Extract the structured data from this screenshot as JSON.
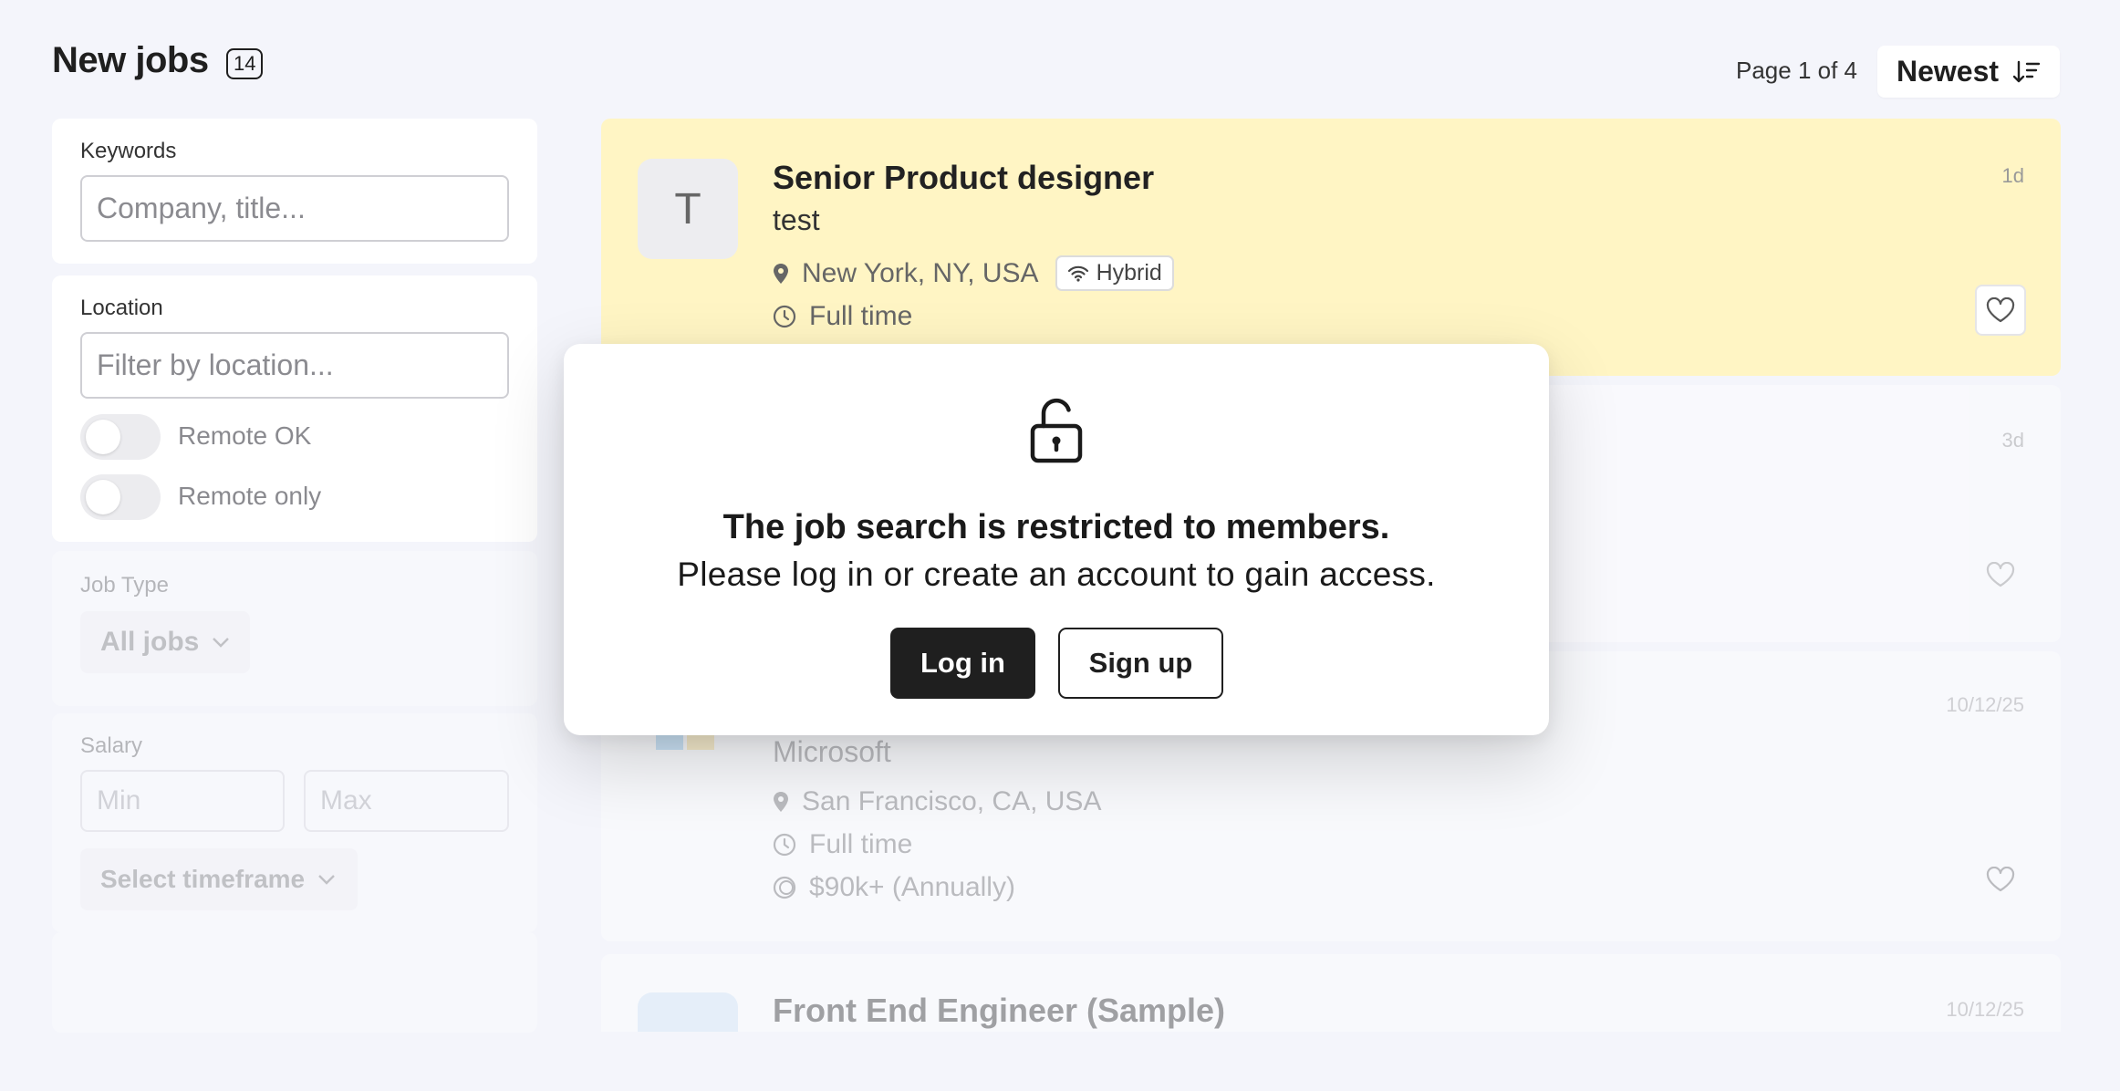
{
  "header": {
    "title": "New jobs",
    "count": "14",
    "page_indicator": "Page 1 of 4",
    "sort_label": "Newest"
  },
  "filters": {
    "keywords_label": "Keywords",
    "keywords_placeholder": "Company, title...",
    "location_label": "Location",
    "location_placeholder": "Filter by location...",
    "remote_ok_label": "Remote OK",
    "remote_only_label": "Remote only",
    "job_type_label": "Job Type",
    "job_type_value": "All jobs",
    "salary_label": "Salary",
    "salary_min_placeholder": "Min",
    "salary_max_placeholder": "Max",
    "timeframe_label": "Select timeframe"
  },
  "jobs": [
    {
      "logo_letter": "T",
      "title": "Senior Product designer",
      "company": "test",
      "location": "New York, NY, USA",
      "workplace": "Hybrid",
      "employment": "Full time",
      "posted": "1d"
    },
    {
      "posted": "3d"
    },
    {
      "company": "Microsoft",
      "location": "San Francisco, CA, USA",
      "employment": "Full time",
      "salary": "$90k+ (Annually)",
      "posted": "10/12/25"
    },
    {
      "title": "Front End Engineer (Sample)",
      "posted": "10/12/25"
    }
  ],
  "modal": {
    "title": "The job search is restricted to members.",
    "subtitle": "Please log in or create an account to gain access.",
    "login_label": "Log in",
    "signup_label": "Sign up"
  },
  "colors": {
    "featured_card": "#fff5c4",
    "page_background": "#f4f5fb",
    "primary_button": "#1f1f1f"
  }
}
